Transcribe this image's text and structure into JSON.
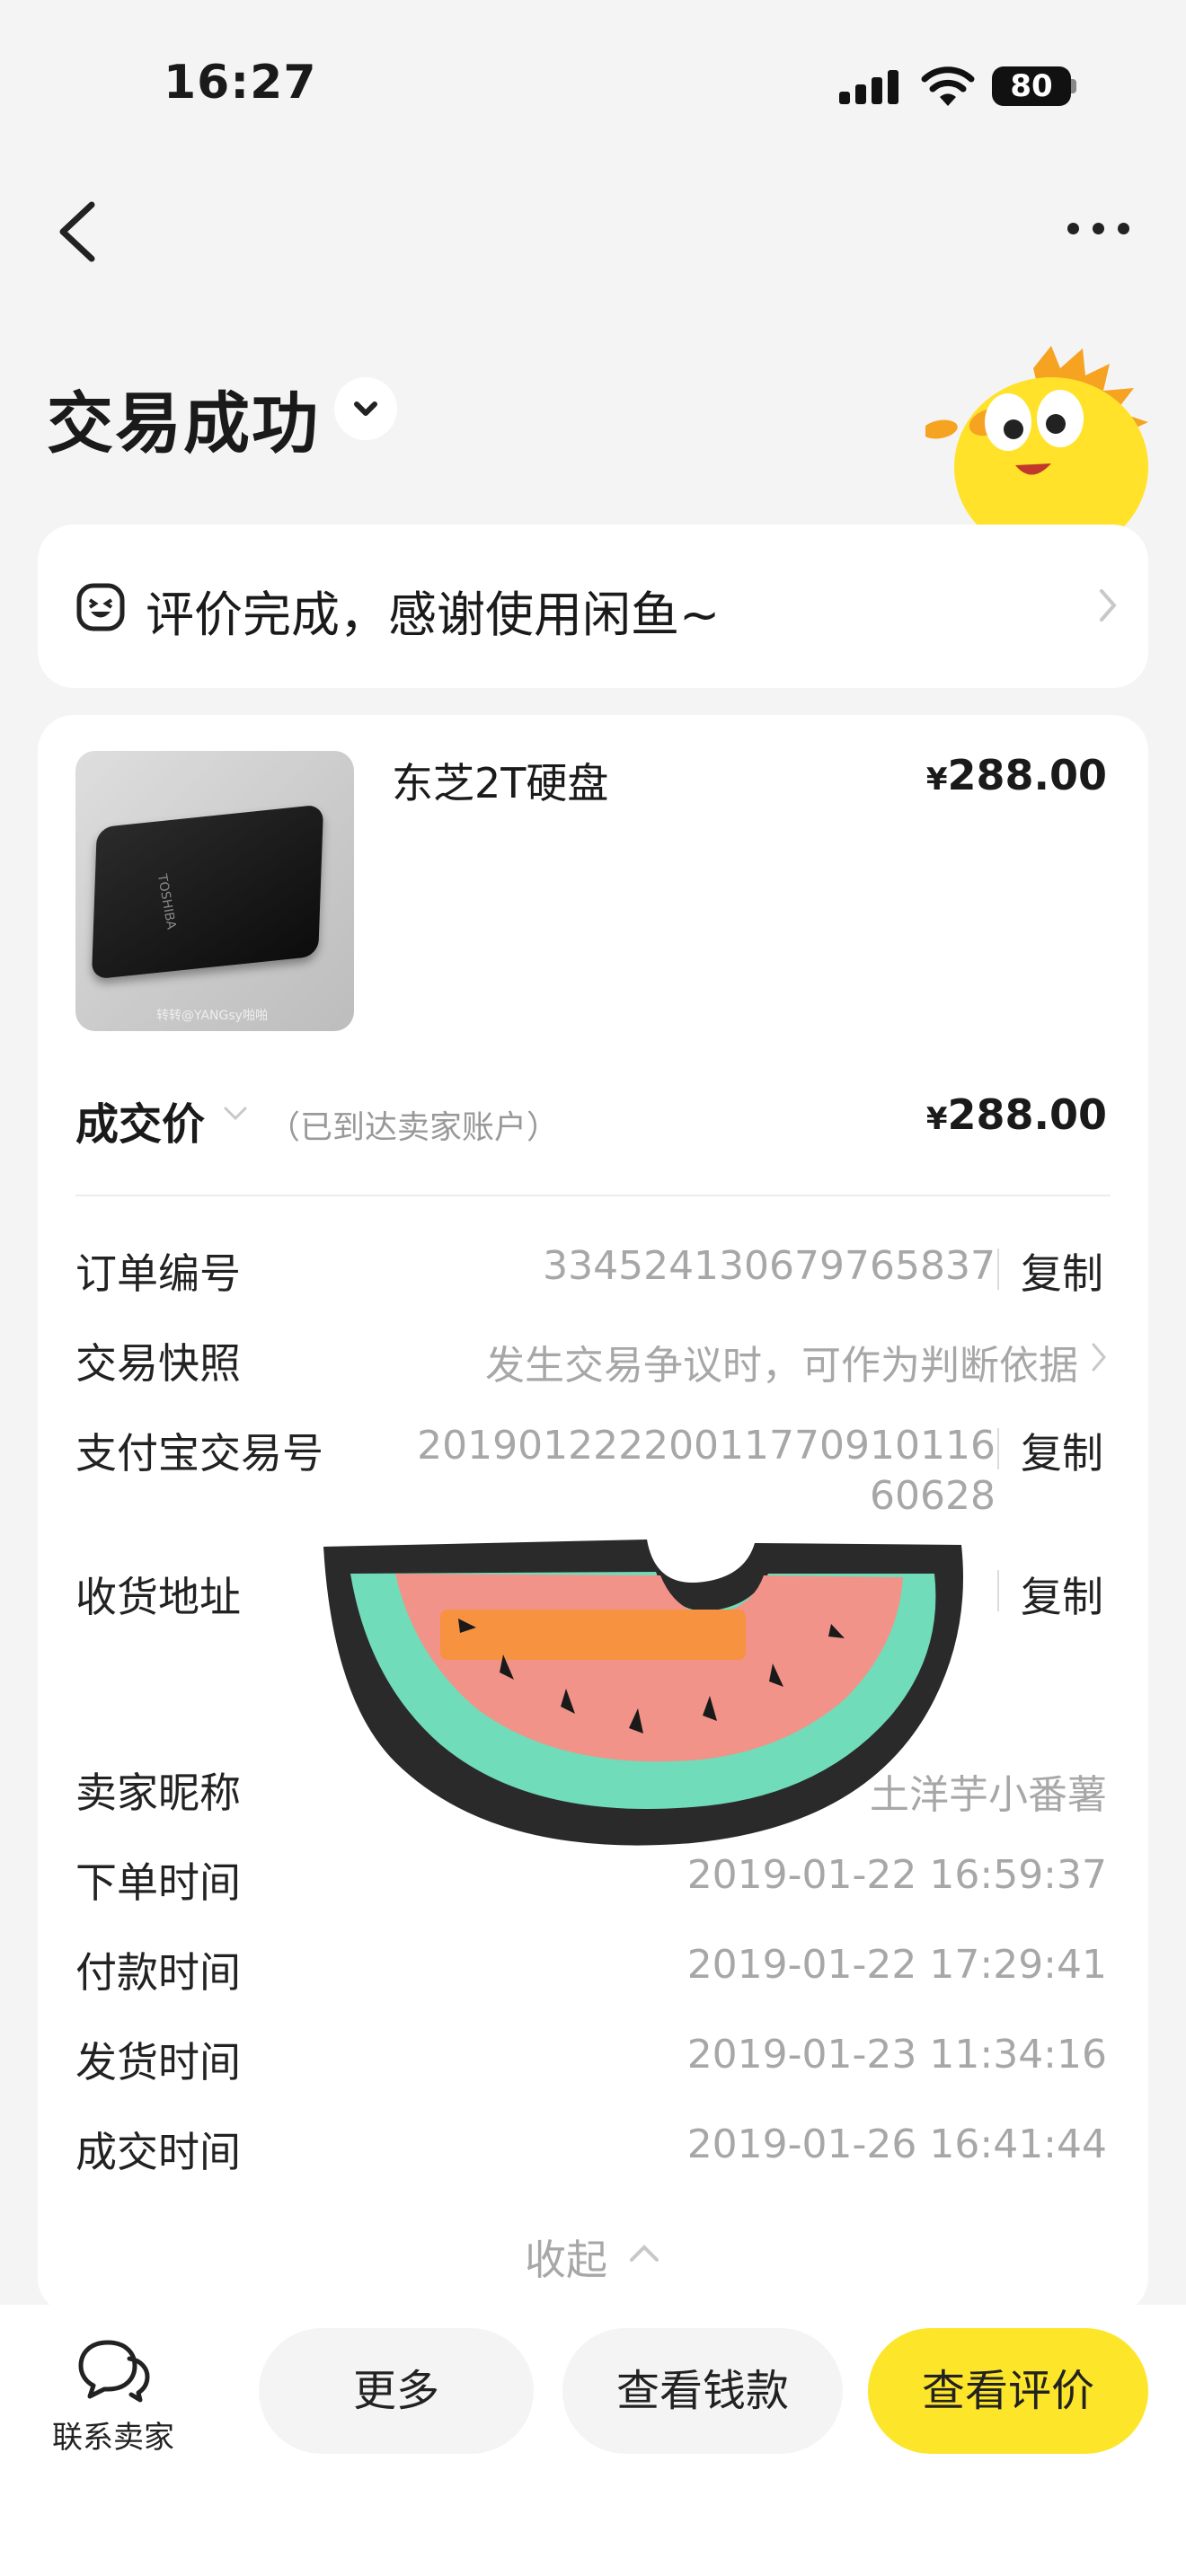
{
  "status_bar": {
    "time": "16:27",
    "battery": "80"
  },
  "header": {
    "title": "交易成功"
  },
  "review_banner": {
    "text": "评价完成，感谢使用闲鱼~"
  },
  "product": {
    "name": "东芝2T硬盘",
    "price_symbol": "¥",
    "price": "288.00",
    "thumb_brand": "TOSHIBA",
    "thumb_watermark": "转转@YANGsy啪啪"
  },
  "deal": {
    "label": "成交价",
    "note": "（已到达卖家账户）",
    "price_symbol": "¥",
    "price": "288.00"
  },
  "details": {
    "order_no_label": "订单编号",
    "order_no": "334524130679765837",
    "snapshot_label": "交易快照",
    "snapshot_hint": "发生交易争议时，可作为判断依据",
    "alipay_label": "支付宝交易号",
    "alipay_line1": "20190122220011770910116",
    "alipay_line2": "60628",
    "address_label": "收货地址",
    "seller_label": "卖家昵称",
    "seller_value": "土洋芋小番薯",
    "order_time_label": "下单时间",
    "order_time": "2019-01-22 16:59:37",
    "pay_time_label": "付款时间",
    "pay_time": "2019-01-22 17:29:41",
    "ship_time_label": "发货时间",
    "ship_time": "2019-01-23 11:34:16",
    "deal_time_label": "成交时间",
    "deal_time": "2019-01-26 16:41:44",
    "copy_label": "复制"
  },
  "collapse_label": "收起",
  "bottom_bar": {
    "contact_label": "联系卖家",
    "more_label": "更多",
    "view_money_label": "查看钱款",
    "view_review_label": "查看评价"
  },
  "colors": {
    "accent": "#fde62a",
    "muted_text": "#a7a7a7",
    "background": "#f4f4f4"
  }
}
